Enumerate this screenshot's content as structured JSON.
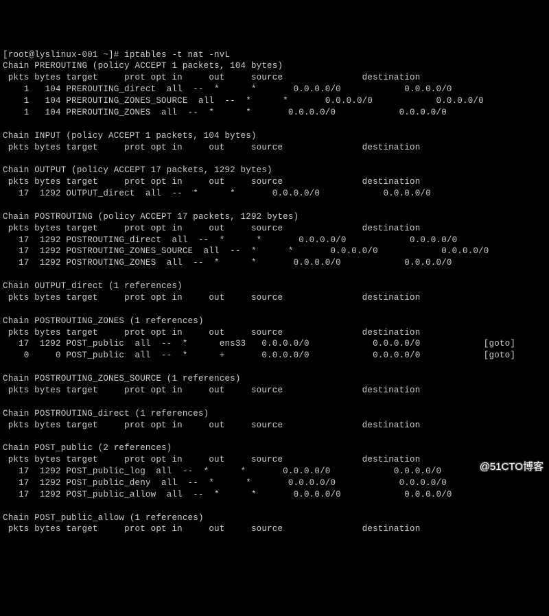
{
  "prompt": {
    "user_host": "[root@lyslinux-001 ~]#",
    "command": "iptables -t nat -nvL"
  },
  "header_line": " pkts bytes target     prot opt in     out     source               destination",
  "chains": [
    {
      "name": "PREROUTING",
      "policy_line": "Chain PREROUTING (policy ACCEPT 1 packets, 104 bytes)",
      "rules": [
        {
          "pkts": "1",
          "bytes": "104",
          "target": "PREROUTING_direct",
          "prot": "all",
          "opt": "--",
          "in": "*",
          "out": "*",
          "source": "0.0.0.0/0",
          "dest": "0.0.0.0/0",
          "extra": ""
        },
        {
          "pkts": "1",
          "bytes": "104",
          "target": "PREROUTING_ZONES_SOURCE",
          "prot": "all",
          "opt": "--",
          "in": "*",
          "out": "*",
          "source": "0.0.0.0/0",
          "dest": "0.0.0.0/0",
          "extra": ""
        },
        {
          "pkts": "1",
          "bytes": "104",
          "target": "PREROUTING_ZONES",
          "prot": "all",
          "opt": "--",
          "in": "*",
          "out": "*",
          "source": "0.0.0.0/0",
          "dest": "0.0.0.0/0",
          "extra": ""
        }
      ]
    },
    {
      "name": "INPUT",
      "policy_line": "Chain INPUT (policy ACCEPT 1 packets, 104 bytes)",
      "rules": []
    },
    {
      "name": "OUTPUT",
      "policy_line": "Chain OUTPUT (policy ACCEPT 17 packets, 1292 bytes)",
      "rules": [
        {
          "pkts": "17",
          "bytes": "1292",
          "target": "OUTPUT_direct",
          "prot": "all",
          "opt": "--",
          "in": "*",
          "out": "*",
          "source": "0.0.0.0/0",
          "dest": "0.0.0.0/0",
          "extra": ""
        }
      ]
    },
    {
      "name": "POSTROUTING",
      "policy_line": "Chain POSTROUTING (policy ACCEPT 17 packets, 1292 bytes)",
      "rules": [
        {
          "pkts": "17",
          "bytes": "1292",
          "target": "POSTROUTING_direct",
          "prot": "all",
          "opt": "--",
          "in": "*",
          "out": "*",
          "source": "0.0.0.0/0",
          "dest": "0.0.0.0/0",
          "extra": ""
        },
        {
          "pkts": "17",
          "bytes": "1292",
          "target": "POSTROUTING_ZONES_SOURCE",
          "prot": "all",
          "opt": "--",
          "in": "*",
          "out": "*",
          "source": "0.0.0.0/0",
          "dest": "0.0.0.0/0",
          "extra": ""
        },
        {
          "pkts": "17",
          "bytes": "1292",
          "target": "POSTROUTING_ZONES",
          "prot": "all",
          "opt": "--",
          "in": "*",
          "out": "*",
          "source": "0.0.0.0/0",
          "dest": "0.0.0.0/0",
          "extra": ""
        }
      ]
    },
    {
      "name": "OUTPUT_direct",
      "policy_line": "Chain OUTPUT_direct (1 references)",
      "rules": []
    },
    {
      "name": "POSTROUTING_ZONES",
      "policy_line": "Chain POSTROUTING_ZONES (1 references)",
      "rules": [
        {
          "pkts": "17",
          "bytes": "1292",
          "target": "POST_public",
          "prot": "all",
          "opt": "--",
          "in": "*",
          "out": "ens33",
          "source": "0.0.0.0/0",
          "dest": "0.0.0.0/0",
          "extra": "[goto]"
        },
        {
          "pkts": "0",
          "bytes": "0",
          "target": "POST_public",
          "prot": "all",
          "opt": "--",
          "in": "*",
          "out": "+",
          "source": "0.0.0.0/0",
          "dest": "0.0.0.0/0",
          "extra": "[goto]"
        }
      ]
    },
    {
      "name": "POSTROUTING_ZONES_SOURCE",
      "policy_line": "Chain POSTROUTING_ZONES_SOURCE (1 references)",
      "rules": []
    },
    {
      "name": "POSTROUTING_direct",
      "policy_line": "Chain POSTROUTING_direct (1 references)",
      "rules": []
    },
    {
      "name": "POST_public",
      "policy_line": "Chain POST_public (2 references)",
      "rules": [
        {
          "pkts": "17",
          "bytes": "1292",
          "target": "POST_public_log",
          "prot": "all",
          "opt": "--",
          "in": "*",
          "out": "*",
          "source": "0.0.0.0/0",
          "dest": "0.0.0.0/0",
          "extra": ""
        },
        {
          "pkts": "17",
          "bytes": "1292",
          "target": "POST_public_deny",
          "prot": "all",
          "opt": "--",
          "in": "*",
          "out": "*",
          "source": "0.0.0.0/0",
          "dest": "0.0.0.0/0",
          "extra": ""
        },
        {
          "pkts": "17",
          "bytes": "1292",
          "target": "POST_public_allow",
          "prot": "all",
          "opt": "--",
          "in": "*",
          "out": "*",
          "source": "0.0.0.0/0",
          "dest": "0.0.0.0/0",
          "extra": ""
        }
      ]
    },
    {
      "name": "POST_public_allow",
      "policy_line": "Chain POST_public_allow (1 references)",
      "rules": []
    }
  ],
  "watermark": "@51CTO博客"
}
